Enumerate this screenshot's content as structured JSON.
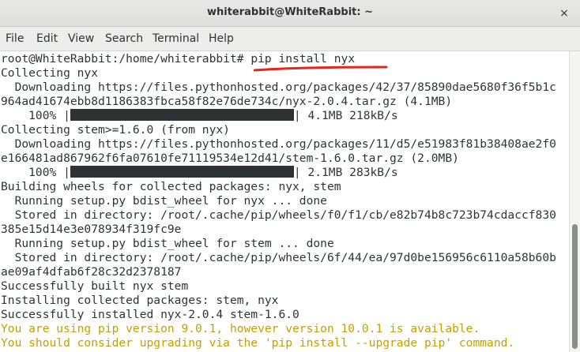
{
  "window": {
    "title": "whiterabbit@WhiteRabbit: ~",
    "close_icon": "×"
  },
  "menu": {
    "items": [
      "File",
      "Edit",
      "View",
      "Search",
      "Terminal",
      "Help"
    ]
  },
  "terminal": {
    "prompt": "root@WhiteRabbit:/home/whiterabbit# ",
    "command": "pip install nyx",
    "lines": [
      "Collecting nyx",
      "  Downloading https://files.pythonhosted.org/packages/42/37/85890dae5680f36f5b1c",
      "964ad41674ebb8d1186383fbca58f82e76de734c/nyx-2.0.4.tar.gz (4.1MB)",
      "    100% |",
      "Collecting stem>=1.6.0 (from nyx)",
      "  Downloading https://files.pythonhosted.org/packages/11/d5/e51983f81b38408ae2f0",
      "e166481ad867962f6fa07610fe71119534e12d41/stem-1.6.0.tar.gz (2.0MB)",
      "    100% |",
      "Building wheels for collected packages: nyx, stem",
      "  Running setup.py bdist_wheel for nyx ... done",
      "  Stored in directory: /root/.cache/pip/wheels/f0/f1/cb/e82b74b8c723b74cdaccf830",
      "385e15d14e3e078934f319fc9e",
      "  Running setup.py bdist_wheel for stem ... done",
      "  Stored in directory: /root/.cache/pip/wheels/6f/44/ea/97d0be156956c6110a58b60b",
      "ae09af4dfab6f28c32d2378187",
      "Successfully built nyx stem",
      "Installing collected packages: stem, nyx",
      "Successfully installed nyx-2.0.4 stem-1.6.0"
    ],
    "progress": [
      {
        "percent": 1.0,
        "tail": "| 4.1MB 218kB/s"
      },
      {
        "percent": 1.0,
        "tail": "| 2.1MB 283kB/s"
      }
    ],
    "warnings": [
      "You are using pip version 9.0.1, however version 10.0.1 is available.",
      "You should consider upgrading via the 'pip install --upgrade pip' command."
    ],
    "annotation_color": "#e8231a",
    "text_color": "#2e3436",
    "warning_color": "#c4a000"
  },
  "scrollbar": {
    "position": 0.83
  }
}
